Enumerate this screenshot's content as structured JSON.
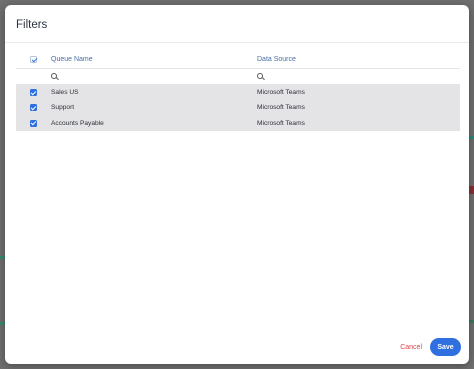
{
  "dialog": {
    "title": "Filters"
  },
  "table": {
    "columns": [
      "Queue Name",
      "Data Source"
    ],
    "rows": [
      {
        "queue": "Sales US",
        "source": "Microsoft Teams",
        "checked": true
      },
      {
        "queue": "Support",
        "source": "Microsoft Teams",
        "checked": true
      },
      {
        "queue": "Accounts Payable",
        "source": "Microsoft Teams",
        "checked": true
      }
    ],
    "select_all_checked": true
  },
  "footer": {
    "cancel_label": "Cancel",
    "save_label": "Save"
  },
  "colors": {
    "accent": "#2f6fe0",
    "cancel": "#e0434a",
    "row_bg": "#e4e4e6"
  }
}
